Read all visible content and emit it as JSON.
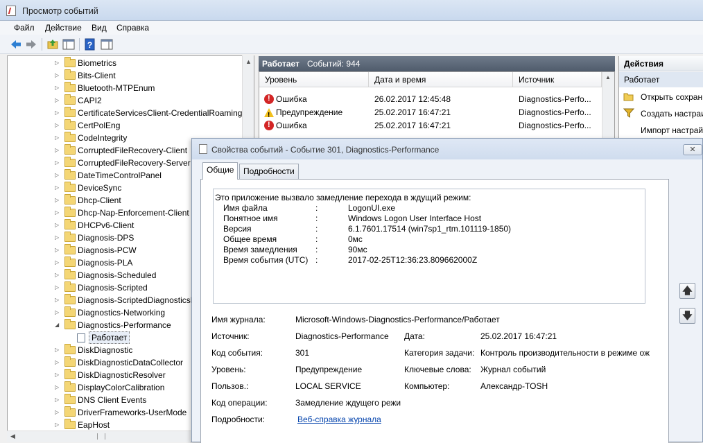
{
  "window": {
    "title": "Просмотр событий"
  },
  "menu": [
    "Файл",
    "Действие",
    "Вид",
    "Справка"
  ],
  "toolbar_icons": [
    "back-arrow-icon",
    "forward-arrow-icon",
    "up-folder-icon",
    "show-hide-tree-icon",
    "help-icon",
    "properties-icon"
  ],
  "tree": {
    "items": [
      {
        "label": "Biometrics",
        "arrow": "▷"
      },
      {
        "label": "Bits-Client",
        "arrow": "▷"
      },
      {
        "label": "Bluetooth-MTPEnum",
        "arrow": "▷"
      },
      {
        "label": "CAPI2",
        "arrow": "▷"
      },
      {
        "label": "CertificateServicesClient-CredentialRoaming",
        "arrow": "▷"
      },
      {
        "label": "CertPolEng",
        "arrow": "▷"
      },
      {
        "label": "CodeIntegrity",
        "arrow": "▷"
      },
      {
        "label": "CorruptedFileRecovery-Client",
        "arrow": "▷"
      },
      {
        "label": "CorruptedFileRecovery-Server",
        "arrow": "▷"
      },
      {
        "label": "DateTimeControlPanel",
        "arrow": "▷"
      },
      {
        "label": "DeviceSync",
        "arrow": "▷"
      },
      {
        "label": "Dhcp-Client",
        "arrow": "▷"
      },
      {
        "label": "Dhcp-Nap-Enforcement-Client",
        "arrow": "▷"
      },
      {
        "label": "DHCPv6-Client",
        "arrow": "▷"
      },
      {
        "label": "Diagnosis-DPS",
        "arrow": "▷"
      },
      {
        "label": "Diagnosis-PCW",
        "arrow": "▷"
      },
      {
        "label": "Diagnosis-PLA",
        "arrow": "▷"
      },
      {
        "label": "Diagnosis-Scheduled",
        "arrow": "▷"
      },
      {
        "label": "Diagnosis-Scripted",
        "arrow": "▷"
      },
      {
        "label": "Diagnosis-ScriptedDiagnosticsProvider",
        "arrow": "▷"
      },
      {
        "label": "Diagnostics-Networking",
        "arrow": "▷"
      },
      {
        "label": "Diagnostics-Performance",
        "arrow": "◢"
      },
      {
        "label": "Работает",
        "arrow": "",
        "child": true
      },
      {
        "label": "DiskDiagnostic",
        "arrow": "▷"
      },
      {
        "label": "DiskDiagnosticDataCollector",
        "arrow": "▷"
      },
      {
        "label": "DiskDiagnosticResolver",
        "arrow": "▷"
      },
      {
        "label": "DisplayColorCalibration",
        "arrow": "▷"
      },
      {
        "label": "DNS Client Events",
        "arrow": "▷"
      },
      {
        "label": "DriverFrameworks-UserMode",
        "arrow": "▷"
      },
      {
        "label": "EapHost",
        "arrow": "▷"
      }
    ]
  },
  "center": {
    "log_name": "Работает",
    "event_count": "Событий: 944",
    "columns": [
      "Уровень",
      "Дата и время",
      "Источник"
    ],
    "rows": [
      {
        "level": "Ошибка",
        "level_icon": "error-icon",
        "datetime": "26.02.2017 12:45:48",
        "source": "Diagnostics-Perfo..."
      },
      {
        "level": "Предупреждение",
        "level_icon": "warning-icon",
        "datetime": "25.02.2017 16:47:21",
        "source": "Diagnostics-Perfo..."
      },
      {
        "level": "Ошибка",
        "level_icon": "error-icon",
        "datetime": "25.02.2017 16:47:21",
        "source": "Diagnostics-Perfo..."
      }
    ]
  },
  "actions": {
    "title": "Действия",
    "subtitle": "Работает",
    "items": [
      "Открыть сохран",
      "Создать настраи",
      "Импорт настрай"
    ]
  },
  "dialog": {
    "title": "Свойства событий - Событие 301, Diagnostics-Performance",
    "close_label": "✕",
    "tabs": [
      "Общие",
      "Подробности"
    ],
    "description_header": "Это приложение вызвало замедление перехода в ждущий режим:",
    "description_rows": [
      {
        "key": "Имя файла",
        "sep": ":",
        "value": "LogonUI.exe"
      },
      {
        "key": "Понятное имя",
        "sep": ":",
        "value": "Windows Logon User Interface Host"
      },
      {
        "key": "Версия",
        "sep": ":",
        "value": "6.1.7601.17514 (win7sp1_rtm.101119-1850)"
      },
      {
        "key": "Общее время",
        "sep": ":",
        "value": "0мс"
      },
      {
        "key": "Время замедления",
        "sep": ":",
        "value": "90мс"
      },
      {
        "key": "Время события (UTC)",
        "sep": ":",
        "value": "2017-02-25T12:36:23.809662000Z"
      }
    ],
    "props": {
      "log_name_label": "Имя журнала:",
      "log_name_value": "Microsoft-Windows-Diagnostics-Performance/Работает",
      "source_label": "Источник:",
      "source_value": "Diagnostics-Performance",
      "date_label": "Дата:",
      "date_value": "25.02.2017 16:47:21",
      "event_id_label": "Код события:",
      "event_id_value": "301",
      "task_category_label": "Категория задачи:",
      "task_category_value": "Контроль производительности в режиме ож",
      "level_label": "Уровень:",
      "level_value": "Предупреждение",
      "keywords_label": "Ключевые слова:",
      "keywords_value": "Журнал событий",
      "user_label": "Пользов.:",
      "user_value": "LOCAL SERVICE",
      "computer_label": "Компьютер:",
      "computer_value": "Александр-TOSH",
      "opcode_label": "Код операции:",
      "opcode_value": "Замедление ждущего режи",
      "more_info_label": "Подробности:",
      "more_info_link": "Веб-справка журнала"
    },
    "side_buttons": {
      "up": "🡅",
      "down": "🡇"
    }
  }
}
